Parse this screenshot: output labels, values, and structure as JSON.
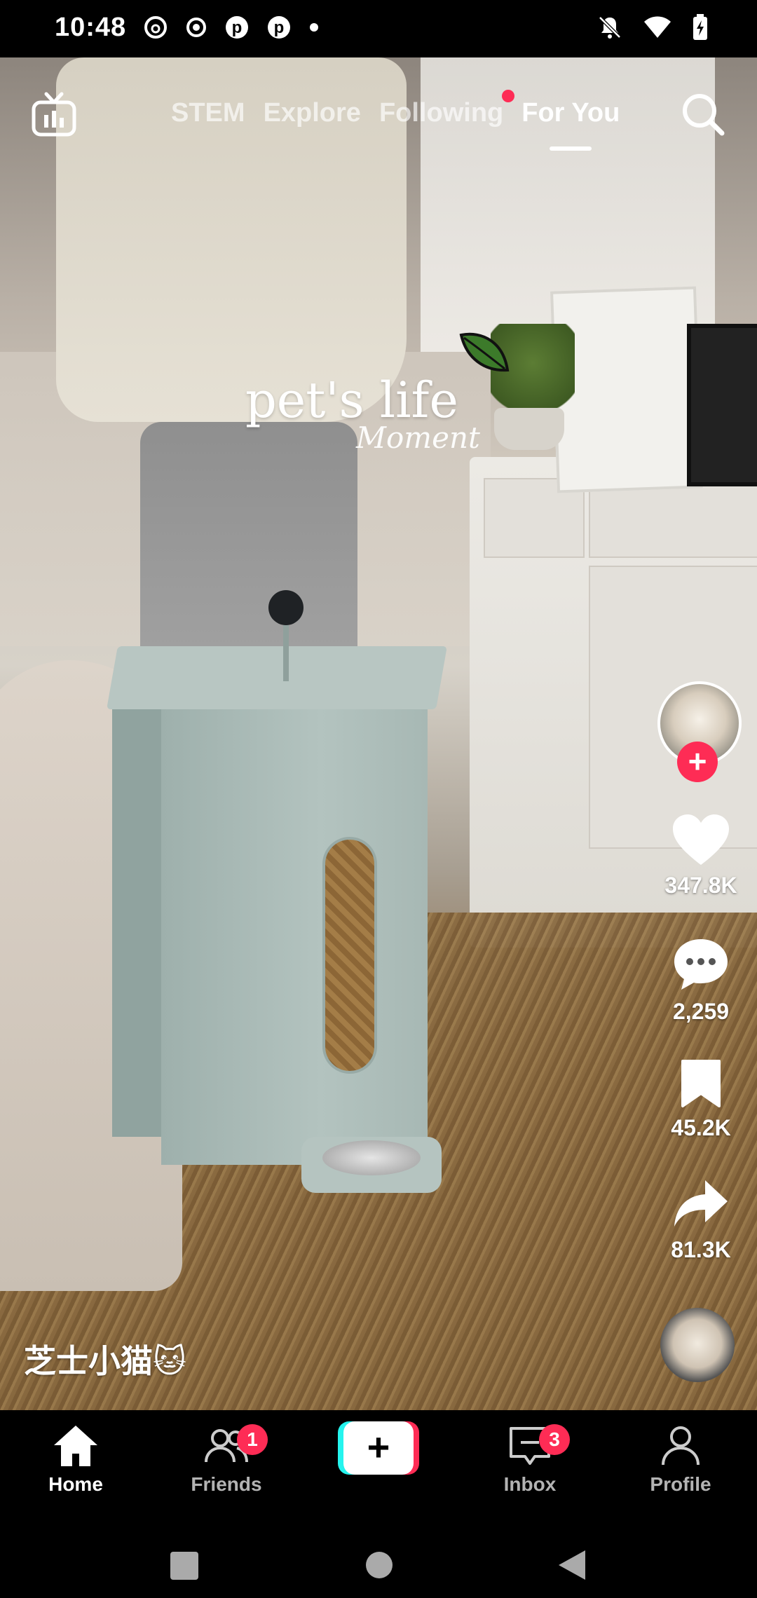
{
  "status_bar": {
    "time": "10:48",
    "left_icons": [
      "threads-icon",
      "record-icon",
      "pinterest-icon",
      "pinterest-icon",
      "dot-icon"
    ],
    "right_icons": [
      "mute-icon",
      "wifi-icon",
      "battery-charging-icon"
    ]
  },
  "video": {
    "overlay_title": "pet's life",
    "overlay_script": "Moment"
  },
  "top_nav": {
    "tabs": [
      {
        "label": "STEM",
        "active": false
      },
      {
        "label": "Explore",
        "active": false
      },
      {
        "label": "Following",
        "active": false,
        "has_dot": true
      },
      {
        "label": "For You",
        "active": true
      }
    ]
  },
  "right_rail": {
    "likes": "347.8K",
    "comments": "2,259",
    "bookmarks": "45.2K",
    "shares": "81.3K",
    "follow_symbol": "+"
  },
  "author": {
    "name": "芝士小猫🐱"
  },
  "bottom_nav": {
    "items": [
      {
        "label": "Home",
        "active": true
      },
      {
        "label": "Friends",
        "badge": "1"
      },
      {
        "label": "Inbox",
        "badge": "3"
      },
      {
        "label": "Profile"
      }
    ],
    "create_symbol": "+"
  },
  "colors": {
    "accent": "#fe2c55",
    "cyan": "#25f4ee"
  }
}
